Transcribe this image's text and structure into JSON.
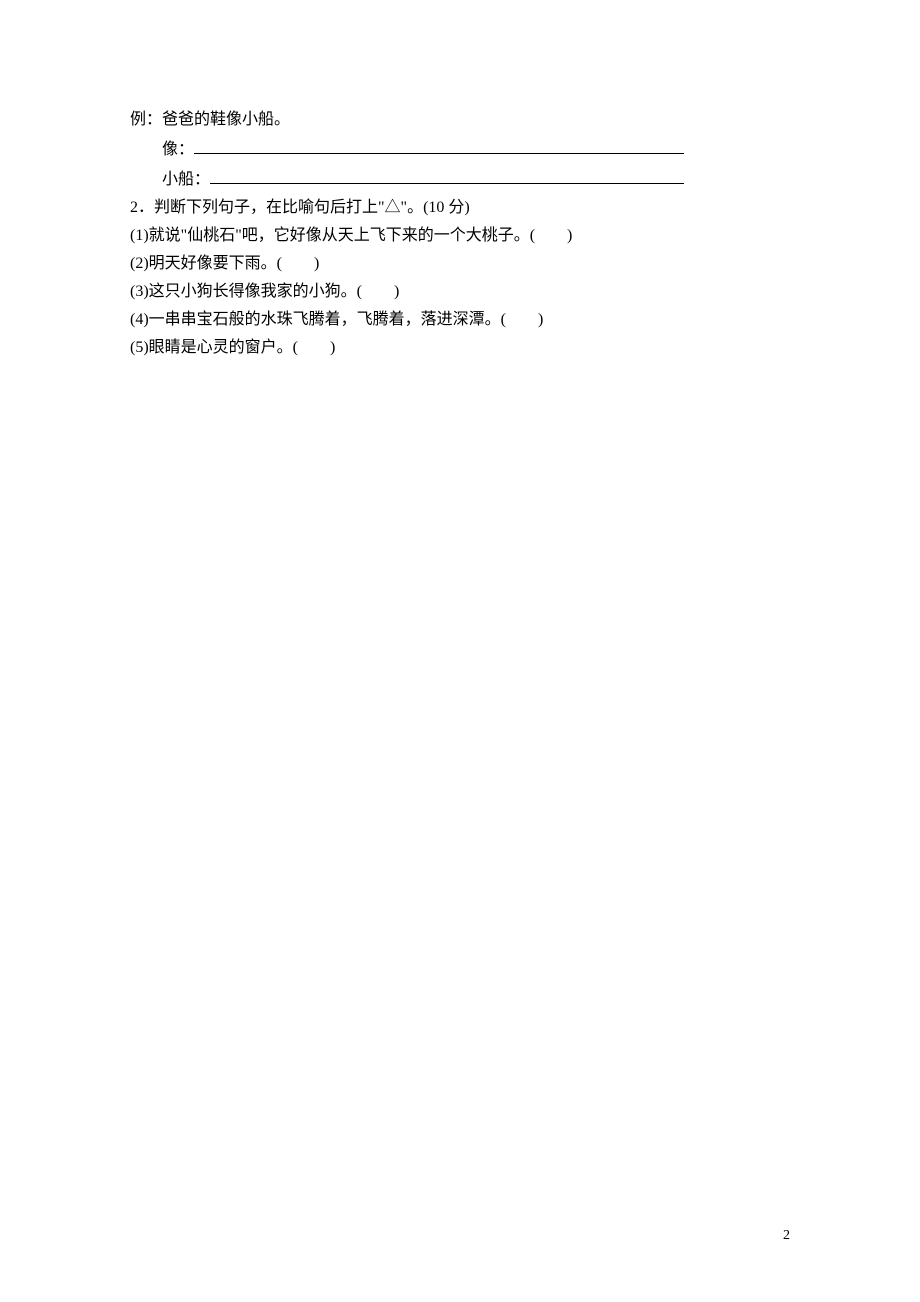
{
  "example": {
    "prefix": "例：",
    "text": "爸爸的鞋像小船。",
    "line1_label": "像：",
    "line2_label": "小船："
  },
  "q2": {
    "header": "2．判断下列句子，在比喻句后打上\"△\"。(10 分)",
    "items": [
      "(1)就说\"仙桃石\"吧，它好像从天上飞下来的一个大桃子。(　　)",
      "(2)明天好像要下雨。(　　)",
      "(3)这只小狗长得像我家的小狗。(　　)",
      "(4)一串串宝石般的水珠飞腾着，飞腾着，落进深潭。(　　)",
      "(5)眼睛是心灵的窗户。(　　)"
    ]
  },
  "page_number": "2"
}
